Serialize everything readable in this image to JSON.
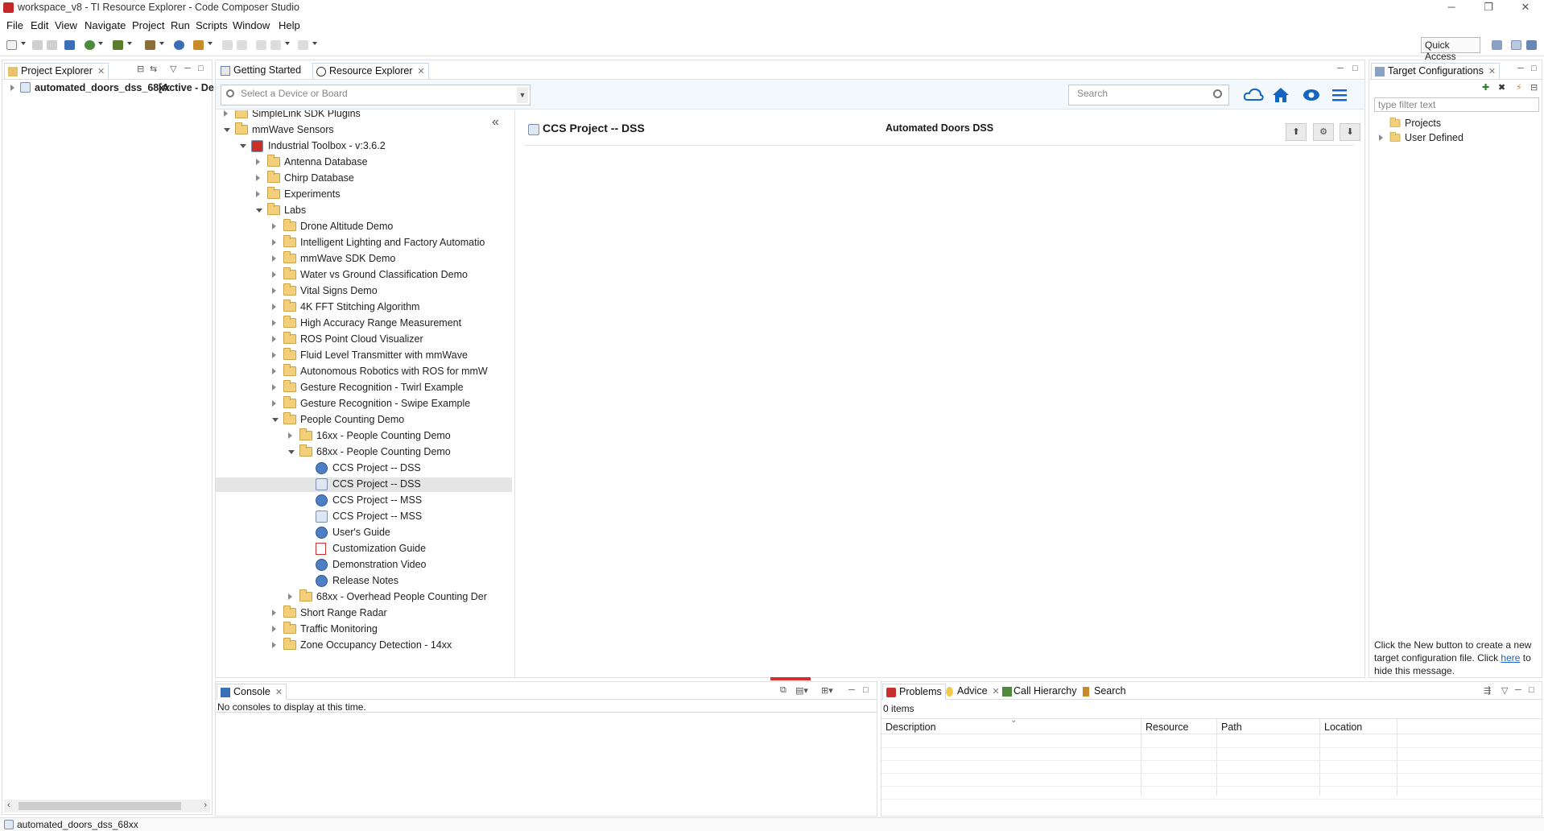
{
  "window": {
    "title": "workspace_v8 - TI Resource Explorer - Code Composer Studio",
    "controls": {
      "minimize": "─",
      "restore": "❐",
      "close": "✕"
    }
  },
  "menu": [
    "File",
    "Edit",
    "View",
    "Navigate",
    "Project",
    "Run",
    "Scripts",
    "Window",
    "Help"
  ],
  "toolbar": {
    "quick_access": "Quick Access"
  },
  "project_explorer": {
    "tab_label": "Project Explorer",
    "item": "automated_doors_dss_68xx",
    "item_suffix": "[Active - De"
  },
  "editor": {
    "tabs": [
      "Getting Started",
      "Resource Explorer"
    ],
    "device_placeholder": "Select a Device or Board",
    "search_placeholder": "Search",
    "collapse_glyph": "«",
    "tree": [
      {
        "label": "SimpleLink SDK Plugins",
        "depth": 0,
        "state": "c",
        "icon": "folder"
      },
      {
        "label": "mmWave Sensors",
        "depth": 0,
        "state": "o",
        "icon": "folder"
      },
      {
        "label": "Industrial Toolbox - v:3.6.2",
        "depth": 1,
        "state": "o",
        "icon": "package"
      },
      {
        "label": "Antenna Database",
        "depth": 2,
        "state": "c",
        "icon": "folder"
      },
      {
        "label": "Chirp Database",
        "depth": 2,
        "state": "c",
        "icon": "folder"
      },
      {
        "label": "Experiments",
        "depth": 2,
        "state": "c",
        "icon": "folder"
      },
      {
        "label": "Labs",
        "depth": 2,
        "state": "o",
        "icon": "folder"
      },
      {
        "label": "Drone Altitude Demo",
        "depth": 3,
        "state": "c",
        "icon": "folder"
      },
      {
        "label": "Intelligent Lighting and Factory Automatio",
        "depth": 3,
        "state": "c",
        "icon": "folder"
      },
      {
        "label": "mmWave SDK Demo",
        "depth": 3,
        "state": "c",
        "icon": "folder"
      },
      {
        "label": "Water vs Ground Classification Demo",
        "depth": 3,
        "state": "c",
        "icon": "folder"
      },
      {
        "label": "Vital Signs Demo",
        "depth": 3,
        "state": "c",
        "icon": "folder"
      },
      {
        "label": "4K FFT Stitching Algorithm",
        "depth": 3,
        "state": "c",
        "icon": "folder"
      },
      {
        "label": "High Accuracy Range Measurement",
        "depth": 3,
        "state": "c",
        "icon": "folder"
      },
      {
        "label": "ROS Point Cloud Visualizer",
        "depth": 3,
        "state": "c",
        "icon": "folder"
      },
      {
        "label": "Fluid Level Transmitter with mmWave",
        "depth": 3,
        "state": "c",
        "icon": "folder"
      },
      {
        "label": "Autonomous Robotics with ROS for mmW",
        "depth": 3,
        "state": "c",
        "icon": "folder"
      },
      {
        "label": "Gesture Recognition - Twirl Example",
        "depth": 3,
        "state": "c",
        "icon": "folder"
      },
      {
        "label": "Gesture Recognition - Swipe Example",
        "depth": 3,
        "state": "c",
        "icon": "folder"
      },
      {
        "label": "People Counting Demo",
        "depth": 3,
        "state": "o",
        "icon": "folder"
      },
      {
        "label": "16xx - People Counting Demo",
        "depth": 4,
        "state": "c",
        "icon": "folder"
      },
      {
        "label": "68xx - People Counting Demo",
        "depth": 4,
        "state": "o",
        "icon": "folder"
      },
      {
        "label": "CCS Project -- DSS",
        "depth": 5,
        "state": "",
        "icon": "resource"
      },
      {
        "label": "CCS Project -- DSS",
        "depth": 5,
        "state": "",
        "icon": "project",
        "selected": true
      },
      {
        "label": "CCS Project -- MSS",
        "depth": 5,
        "state": "",
        "icon": "resource"
      },
      {
        "label": "CCS Project -- MSS",
        "depth": 5,
        "state": "",
        "icon": "project"
      },
      {
        "label": "User's Guide",
        "depth": 5,
        "state": "",
        "icon": "resource"
      },
      {
        "label": "Customization Guide",
        "depth": 5,
        "state": "",
        "icon": "pdf"
      },
      {
        "label": "Demonstration Video",
        "depth": 5,
        "state": "",
        "icon": "resource"
      },
      {
        "label": "Release Notes",
        "depth": 5,
        "state": "",
        "icon": "resource"
      },
      {
        "label": "68xx - Overhead People Counting Der",
        "depth": 4,
        "state": "c",
        "icon": "folder"
      },
      {
        "label": "Short Range Radar",
        "depth": 3,
        "state": "c",
        "icon": "folder"
      },
      {
        "label": "Traffic Monitoring",
        "depth": 3,
        "state": "c",
        "icon": "folder"
      },
      {
        "label": "Zone Occupancy Detection - 14xx",
        "depth": 3,
        "state": "c",
        "icon": "folder"
      }
    ],
    "detail": {
      "title": "CCS Project -- DSS",
      "name": "Automated Doors DSS"
    }
  },
  "target_config": {
    "tab_label": "Target Configurations",
    "filter_placeholder": "type filter text",
    "items": [
      "Projects",
      "User Defined"
    ],
    "message_pre": "Click the New button to create a new target configuration file. Click ",
    "message_link": "here",
    "message_post": " to hide this message."
  },
  "console": {
    "tab_label": "Console",
    "message": "No consoles to display at this time."
  },
  "problems": {
    "tabs": [
      "Problems",
      "Advice",
      "Call Hierarchy",
      "Search"
    ],
    "count": "0 items",
    "columns": [
      "Description",
      "Resource",
      "Path",
      "Location"
    ]
  },
  "statusbar": {
    "text": "automated_doors_dss_68xx"
  },
  "colors": {
    "accent": "#1565c0",
    "selection": "#e5e5e5",
    "progress": "#d32f2f"
  }
}
